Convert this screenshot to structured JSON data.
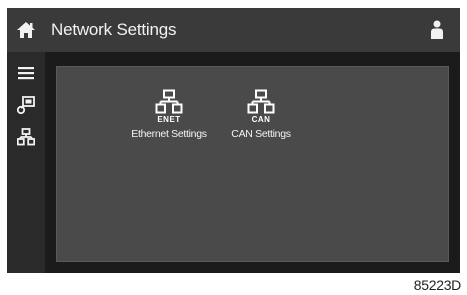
{
  "header": {
    "title": "Network Settings",
    "home_icon": "home-icon",
    "user_icon": "user-icon"
  },
  "sidebar": {
    "items": [
      {
        "icon": "menu-icon"
      },
      {
        "icon": "gauge-icon"
      },
      {
        "icon": "network-icon"
      }
    ]
  },
  "main": {
    "tiles": [
      {
        "tag": "ENET",
        "label": "Ethernet Settings",
        "icon": "network-icon"
      },
      {
        "tag": "CAN",
        "label": "CAN Settings",
        "icon": "network-icon"
      }
    ]
  },
  "footer": {
    "ref_code": "85223D"
  },
  "colors": {
    "topbar": "#3a3a3a",
    "sidebar": "#2a2a2a",
    "panel": "#4a4a4a",
    "background": "#1b1b1b"
  }
}
